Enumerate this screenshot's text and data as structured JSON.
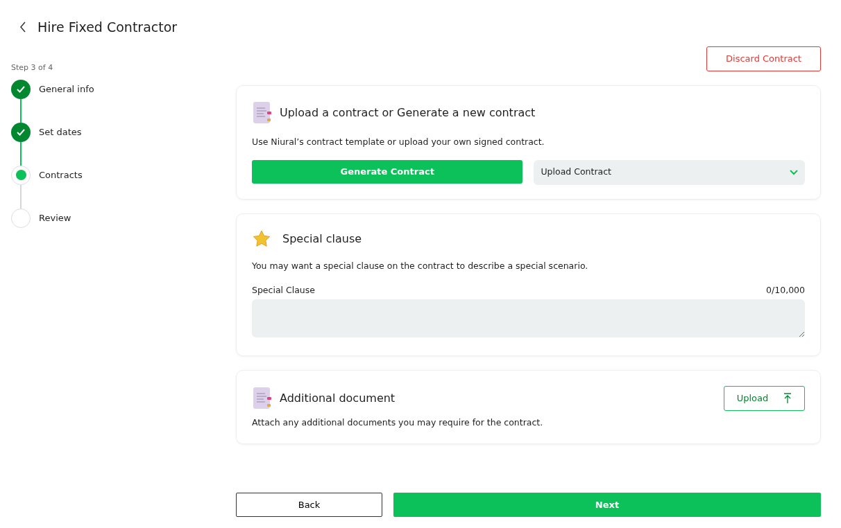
{
  "header": {
    "title": "Hire Fixed Contractor"
  },
  "stepper": {
    "caption": "Step 3 of 4",
    "steps": [
      {
        "label": "General info",
        "kind": "done"
      },
      {
        "label": "Set dates",
        "kind": "done"
      },
      {
        "label": "Contracts",
        "kind": "current"
      },
      {
        "label": "Review",
        "kind": "pending"
      }
    ]
  },
  "discard_button": "Discard Contract",
  "contract_card": {
    "title": "Upload a contract or Generate a new contract",
    "description": "Use Niural’s contract template or upload your own signed contract.",
    "generate_button": "Generate Contract",
    "upload_select": "Upload Contract"
  },
  "special_clause_card": {
    "title": "Special clause",
    "description": "You may want a special clause on the contract to describe a special scenario.",
    "field_label": "Special Clause",
    "counter": "0/10,000"
  },
  "document_card": {
    "title": "Additional document",
    "upload_button": "Upload",
    "description": "Attach any additional documents you may require for the contract."
  },
  "footer": {
    "back_button": "Back",
    "next_button": "Next"
  }
}
